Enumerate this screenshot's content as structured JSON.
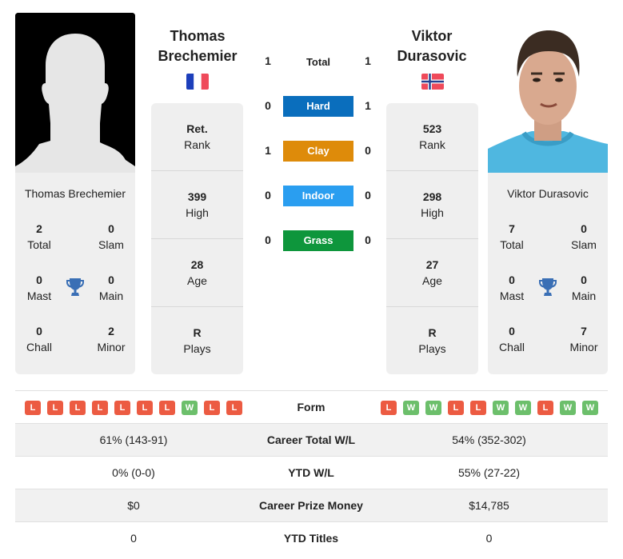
{
  "player1": {
    "name_line1": "Thomas",
    "name_line2": "Brechemier",
    "full_name": "Thomas Brechemier",
    "country_flag": "france-flag",
    "rank": {
      "value": "Ret.",
      "label": "Rank"
    },
    "high": {
      "value": "399",
      "label": "High"
    },
    "age": {
      "value": "28",
      "label": "Age"
    },
    "plays": {
      "value": "R",
      "label": "Plays"
    },
    "titles": {
      "total": {
        "value": "2",
        "label": "Total"
      },
      "slam": {
        "value": "0",
        "label": "Slam"
      },
      "mast": {
        "value": "0",
        "label": "Mast"
      },
      "main": {
        "value": "0",
        "label": "Main"
      },
      "chall": {
        "value": "0",
        "label": "Chall"
      },
      "minor": {
        "value": "2",
        "label": "Minor"
      }
    },
    "form": [
      "L",
      "L",
      "L",
      "L",
      "L",
      "L",
      "L",
      "W",
      "L",
      "L"
    ]
  },
  "player2": {
    "name_line1": "Viktor",
    "name_line2": "Durasovic",
    "full_name": "Viktor Durasovic",
    "country_flag": "norway-flag",
    "rank": {
      "value": "523",
      "label": "Rank"
    },
    "high": {
      "value": "298",
      "label": "High"
    },
    "age": {
      "value": "27",
      "label": "Age"
    },
    "plays": {
      "value": "R",
      "label": "Plays"
    },
    "titles": {
      "total": {
        "value": "7",
        "label": "Total"
      },
      "slam": {
        "value": "0",
        "label": "Slam"
      },
      "mast": {
        "value": "0",
        "label": "Mast"
      },
      "main": {
        "value": "0",
        "label": "Main"
      },
      "chall": {
        "value": "0",
        "label": "Chall"
      },
      "minor": {
        "value": "7",
        "label": "Minor"
      }
    },
    "form": [
      "L",
      "W",
      "W",
      "L",
      "L",
      "W",
      "W",
      "L",
      "W",
      "W"
    ]
  },
  "h2h": {
    "total": {
      "label": "Total",
      "p1": "1",
      "p2": "1"
    },
    "surfaces": [
      {
        "label": "Hard",
        "p1": "0",
        "p2": "1",
        "color": "#0a6ebd"
      },
      {
        "label": "Clay",
        "p1": "1",
        "p2": "0",
        "color": "#de8b0a"
      },
      {
        "label": "Indoor",
        "p1": "0",
        "p2": "0",
        "color": "#2a9ef0"
      },
      {
        "label": "Grass",
        "p1": "0",
        "p2": "0",
        "color": "#0e963c"
      }
    ]
  },
  "table": {
    "form_label": "Form",
    "rows": [
      {
        "label": "Career Total W/L",
        "p1": "61% (143-91)",
        "p2": "54% (352-302)"
      },
      {
        "label": "YTD W/L",
        "p1": "0% (0-0)",
        "p2": "55% (27-22)"
      },
      {
        "label": "Career Prize Money",
        "p1": "$0",
        "p2": "$14,785"
      },
      {
        "label": "YTD Titles",
        "p1": "0",
        "p2": "0"
      }
    ]
  },
  "colors": {
    "loss": "#ec5b42",
    "win": "#6cbf6b",
    "trophy": "#3a6fb5",
    "card_bg": "#efefef"
  }
}
